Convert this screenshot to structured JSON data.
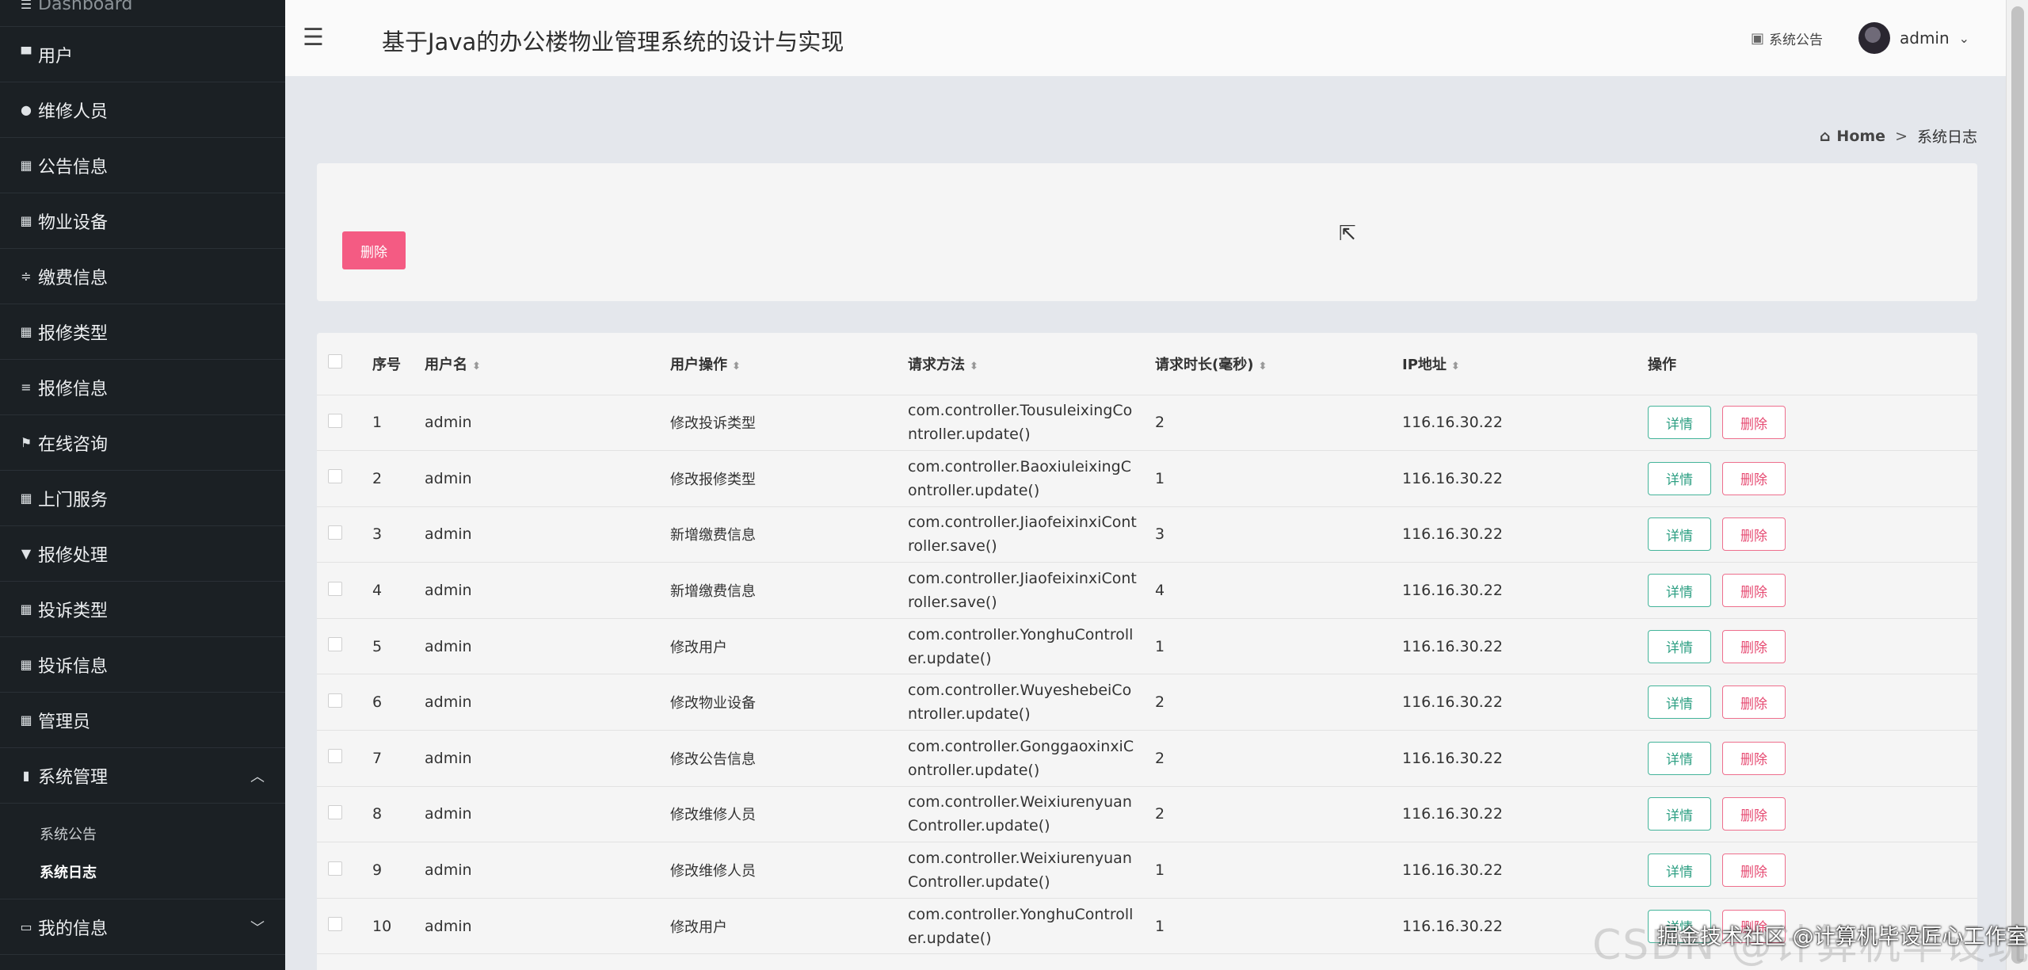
{
  "app": {
    "title": "基于Java的办公楼物业管理系统的设计与实现",
    "notice_label": "系统公告",
    "user_name": "admin"
  },
  "sidebar": {
    "cut_item": "Dashboard",
    "items": [
      {
        "label": "用户",
        "icon": "user-icon"
      },
      {
        "label": "维修人员",
        "icon": "map-pin-icon"
      },
      {
        "label": "公告信息",
        "icon": "grid-icon"
      },
      {
        "label": "物业设备",
        "icon": "grid-icon"
      },
      {
        "label": "缴费信息",
        "icon": "sliders-icon"
      },
      {
        "label": "报修类型",
        "icon": "grid-icon"
      },
      {
        "label": "报修信息",
        "icon": "list-icon"
      },
      {
        "label": "在线咨询",
        "icon": "flag-icon"
      },
      {
        "label": "上门服务",
        "icon": "grid-icon"
      },
      {
        "label": "报修处理",
        "icon": "shield-icon"
      },
      {
        "label": "投诉类型",
        "icon": "grid-icon"
      },
      {
        "label": "投诉信息",
        "icon": "grid-icon"
      },
      {
        "label": "管理员",
        "icon": "grid-icon"
      }
    ],
    "active_group": {
      "label": "系统管理",
      "icon": "book-icon"
    },
    "sub_items": [
      "系统公告",
      "系统日志"
    ],
    "my_info": "我的信息"
  },
  "breadcrumb": {
    "home": "Home",
    "separator": ">",
    "current": "系统日志"
  },
  "toolbar": {
    "delete_label": "删除"
  },
  "table": {
    "headers": {
      "index": "序号",
      "username": "用户名",
      "operation": "用户操作",
      "method": "请求方法",
      "duration": "请求时长(毫秒)",
      "ip": "IP地址",
      "actions": "操作"
    },
    "detail_label": "详情",
    "delete_label": "删除",
    "rows": [
      {
        "index": "1",
        "username": "admin",
        "operation": "修改投诉类型",
        "method": "com.controller.TousuleixingController.update()",
        "duration": "2",
        "ip": "116.16.30.22"
      },
      {
        "index": "2",
        "username": "admin",
        "operation": "修改报修类型",
        "method": "com.controller.BaoxiuleixingController.update()",
        "duration": "1",
        "ip": "116.16.30.22"
      },
      {
        "index": "3",
        "username": "admin",
        "operation": "新增缴费信息",
        "method": "com.controller.JiaofeixinxiController.save()",
        "duration": "3",
        "ip": "116.16.30.22"
      },
      {
        "index": "4",
        "username": "admin",
        "operation": "新增缴费信息",
        "method": "com.controller.JiaofeixinxiController.save()",
        "duration": "4",
        "ip": "116.16.30.22"
      },
      {
        "index": "5",
        "username": "admin",
        "operation": "修改用户",
        "method": "com.controller.YonghuController.update()",
        "duration": "1",
        "ip": "116.16.30.22"
      },
      {
        "index": "6",
        "username": "admin",
        "operation": "修改物业设备",
        "method": "com.controller.WuyeshebeiController.update()",
        "duration": "2",
        "ip": "116.16.30.22"
      },
      {
        "index": "7",
        "username": "admin",
        "operation": "修改公告信息",
        "method": "com.controller.GonggaoxinxiController.update()",
        "duration": "2",
        "ip": "116.16.30.22"
      },
      {
        "index": "8",
        "username": "admin",
        "operation": "修改维修人员",
        "method": "com.controller.WeixiurenyuanController.update()",
        "duration": "2",
        "ip": "116.16.30.22"
      },
      {
        "index": "9",
        "username": "admin",
        "operation": "修改维修人员",
        "method": "com.controller.WeixiurenyuanController.update()",
        "duration": "1",
        "ip": "116.16.30.22"
      },
      {
        "index": "10",
        "username": "admin",
        "operation": "修改用户",
        "method": "com.controller.YonghuController.update()",
        "duration": "1",
        "ip": "116.16.30.22"
      }
    ]
  },
  "watermark": {
    "text": "CSDN @计算机毕设玩哥",
    "overlay": "掘金技术社区 @计算机毕设匠心工作室"
  }
}
